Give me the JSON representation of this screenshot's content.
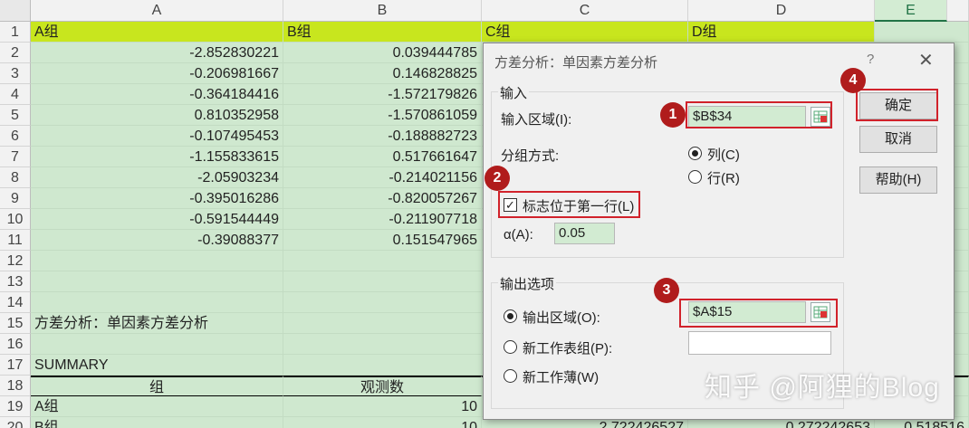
{
  "columns": [
    "A",
    "B",
    "C",
    "D",
    "E"
  ],
  "rows": [
    {
      "n": "1",
      "a": "A组",
      "b": "B组",
      "c": "C组",
      "d": "D组",
      "e": ""
    },
    {
      "n": "2",
      "a": "-2.852830221",
      "b": "0.039444785",
      "c": "",
      "d": "",
      "e": ""
    },
    {
      "n": "3",
      "a": "-0.206981667",
      "b": "0.146828825",
      "c": "",
      "d": "",
      "e": ""
    },
    {
      "n": "4",
      "a": "-0.364184416",
      "b": "-1.572179826",
      "c": "",
      "d": "",
      "e": ""
    },
    {
      "n": "5",
      "a": "0.810352958",
      "b": "-1.570861059",
      "c": "",
      "d": "",
      "e": ""
    },
    {
      "n": "6",
      "a": "-0.107495453",
      "b": "-0.188882723",
      "c": "",
      "d": "",
      "e": ""
    },
    {
      "n": "7",
      "a": "-1.155833615",
      "b": "0.517661647",
      "c": "",
      "d": "",
      "e": ""
    },
    {
      "n": "8",
      "a": "-2.05903234",
      "b": "-0.214021156",
      "c": "",
      "d": "",
      "e": ""
    },
    {
      "n": "9",
      "a": "-0.395016286",
      "b": "-0.820057267",
      "c": "",
      "d": "",
      "e": ""
    },
    {
      "n": "10",
      "a": "-0.591544449",
      "b": "-0.211907718",
      "c": "",
      "d": "",
      "e": ""
    },
    {
      "n": "11",
      "a": "-0.39088377",
      "b": "0.151547965",
      "c": "",
      "d": "",
      "e": ""
    },
    {
      "n": "12",
      "a": "",
      "b": "",
      "c": "",
      "d": "",
      "e": ""
    },
    {
      "n": "13",
      "a": "",
      "b": "",
      "c": "",
      "d": "",
      "e": ""
    },
    {
      "n": "14",
      "a": "",
      "b": "",
      "c": "",
      "d": "",
      "e": ""
    },
    {
      "n": "15",
      "a": "方差分析：单因素方差分析",
      "b": "",
      "c": "",
      "d": "",
      "e": ""
    },
    {
      "n": "16",
      "a": "",
      "b": "",
      "c": "",
      "d": "",
      "e": ""
    },
    {
      "n": "17",
      "a": "SUMMARY",
      "b": "",
      "c": "",
      "d": "",
      "e": ""
    },
    {
      "n": "18",
      "a": "组",
      "b": "观测数",
      "c": "",
      "d": "",
      "e": ""
    },
    {
      "n": "19",
      "a": "A组",
      "b": "10",
      "c": "",
      "d": "",
      "e": ""
    },
    {
      "n": "20",
      "a": "B组",
      "b": "10",
      "c": "2.722426527",
      "d": "0.272242653",
      "e": "0.518516"
    }
  ],
  "dialog": {
    "title": "方差分析：单因素方差分析",
    "help_mark": "?",
    "close": "✕",
    "input_group": "输入",
    "input_range_label": "输入区域(I):",
    "input_range_value": "$B$34",
    "grouped_by_label": "分组方式:",
    "by_column": "列(C)",
    "by_row": "行(R)",
    "labels_first_row": "标志位于第一行(L)",
    "alpha_label": "α(A):",
    "alpha_value": "0.05",
    "output_group": "输出选项",
    "output_range_label": "输出区域(O):",
    "output_range_value": "$A$15",
    "new_sheet_label": "新工作表组(P):",
    "new_sheet_value": "",
    "new_workbook_label": "新工作薄(W)",
    "ok": "确定",
    "cancel": "取消",
    "help": "帮助(H)"
  },
  "badges": [
    "1",
    "2",
    "3",
    "4"
  ],
  "watermark": "知乎 @阿狸的Blog",
  "colors": {
    "header_highlight": "#c8e61e",
    "sheet_bg": "#cfe8cf",
    "badge": "#b01c1c",
    "redbox": "#d1222b"
  }
}
